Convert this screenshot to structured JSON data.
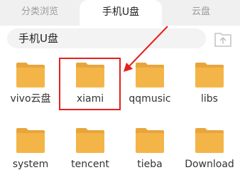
{
  "tabs": {
    "browse": "分类浏览",
    "phone_usb": "手机U盘",
    "cloud": "云盘"
  },
  "path": {
    "current": "手机U盘"
  },
  "folders": [
    {
      "label": "vivo云盘"
    },
    {
      "label": "xiami"
    },
    {
      "label": "qqmusic"
    },
    {
      "label": "libs"
    },
    {
      "label": "system"
    },
    {
      "label": "tencent"
    },
    {
      "label": "tieba"
    },
    {
      "label": "Download"
    }
  ],
  "colors": {
    "folder": "#f4b548",
    "highlight": "#e5201e"
  },
  "icons": {
    "upload": "upload-icon",
    "folder": "folder-icon"
  }
}
